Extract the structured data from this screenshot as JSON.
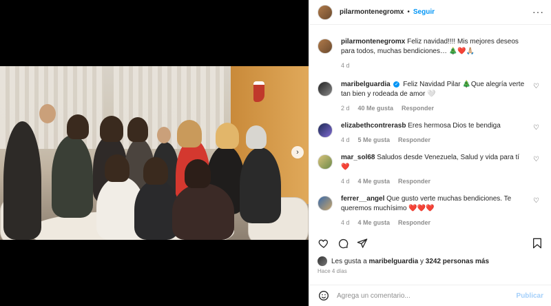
{
  "post": {
    "author": "pilarmontenegromx",
    "follow_label": "Seguir",
    "separator": "•",
    "caption_user": "pilarmontenegromx",
    "caption_text": "Feliz navidad!!!! Mis mejores deseos para todos, muchas bendiciones… 🎄❤️🙏🏼",
    "caption_time": "4 d"
  },
  "comments": [
    {
      "user": "maribelguardia",
      "verified": true,
      "text": "Feliz Navidad Pilar 🎄Que alegría verte tan bien y rodeada de amor 🤍",
      "time": "2 d",
      "likes": "40 Me gusta",
      "reply": "Responder"
    },
    {
      "user": "elizabethcontrerasb",
      "text": "Eres hermosa Dios te bendiga",
      "time": "4 d",
      "likes": "5 Me gusta",
      "reply": "Responder"
    },
    {
      "user": "mar_sol68",
      "text": "Saludos desde Venezuela, Salud y vida para tí ❤️",
      "time": "4 d",
      "likes": "4 Me gusta",
      "reply": "Responder"
    },
    {
      "user": "ferrer__angel",
      "text": "Que gusto verte muchas bendiciones. Te queremos muchísimo ❤️❤️❤️",
      "time": "4 d",
      "likes": "4 Me gusta",
      "reply": "Responder"
    }
  ],
  "likes": {
    "prefix": "Les gusta a",
    "user": "maribelguardia",
    "connector": "y",
    "count": "3242 personas más"
  },
  "time_ago": "Hace 4 días",
  "composer": {
    "placeholder": "Agrega un comentario...",
    "publish_label": "Publicar"
  },
  "icons": {
    "more": "more-options-icon",
    "heart": "heart-icon",
    "comment": "comment-icon",
    "share": "share-icon",
    "save": "bookmark-icon",
    "emoji": "emoji-icon",
    "next": "chevron-right-icon"
  },
  "colors": {
    "accent": "#0095f6",
    "publish_disabled": "#a3cffa",
    "muted": "#8e8e8e"
  }
}
